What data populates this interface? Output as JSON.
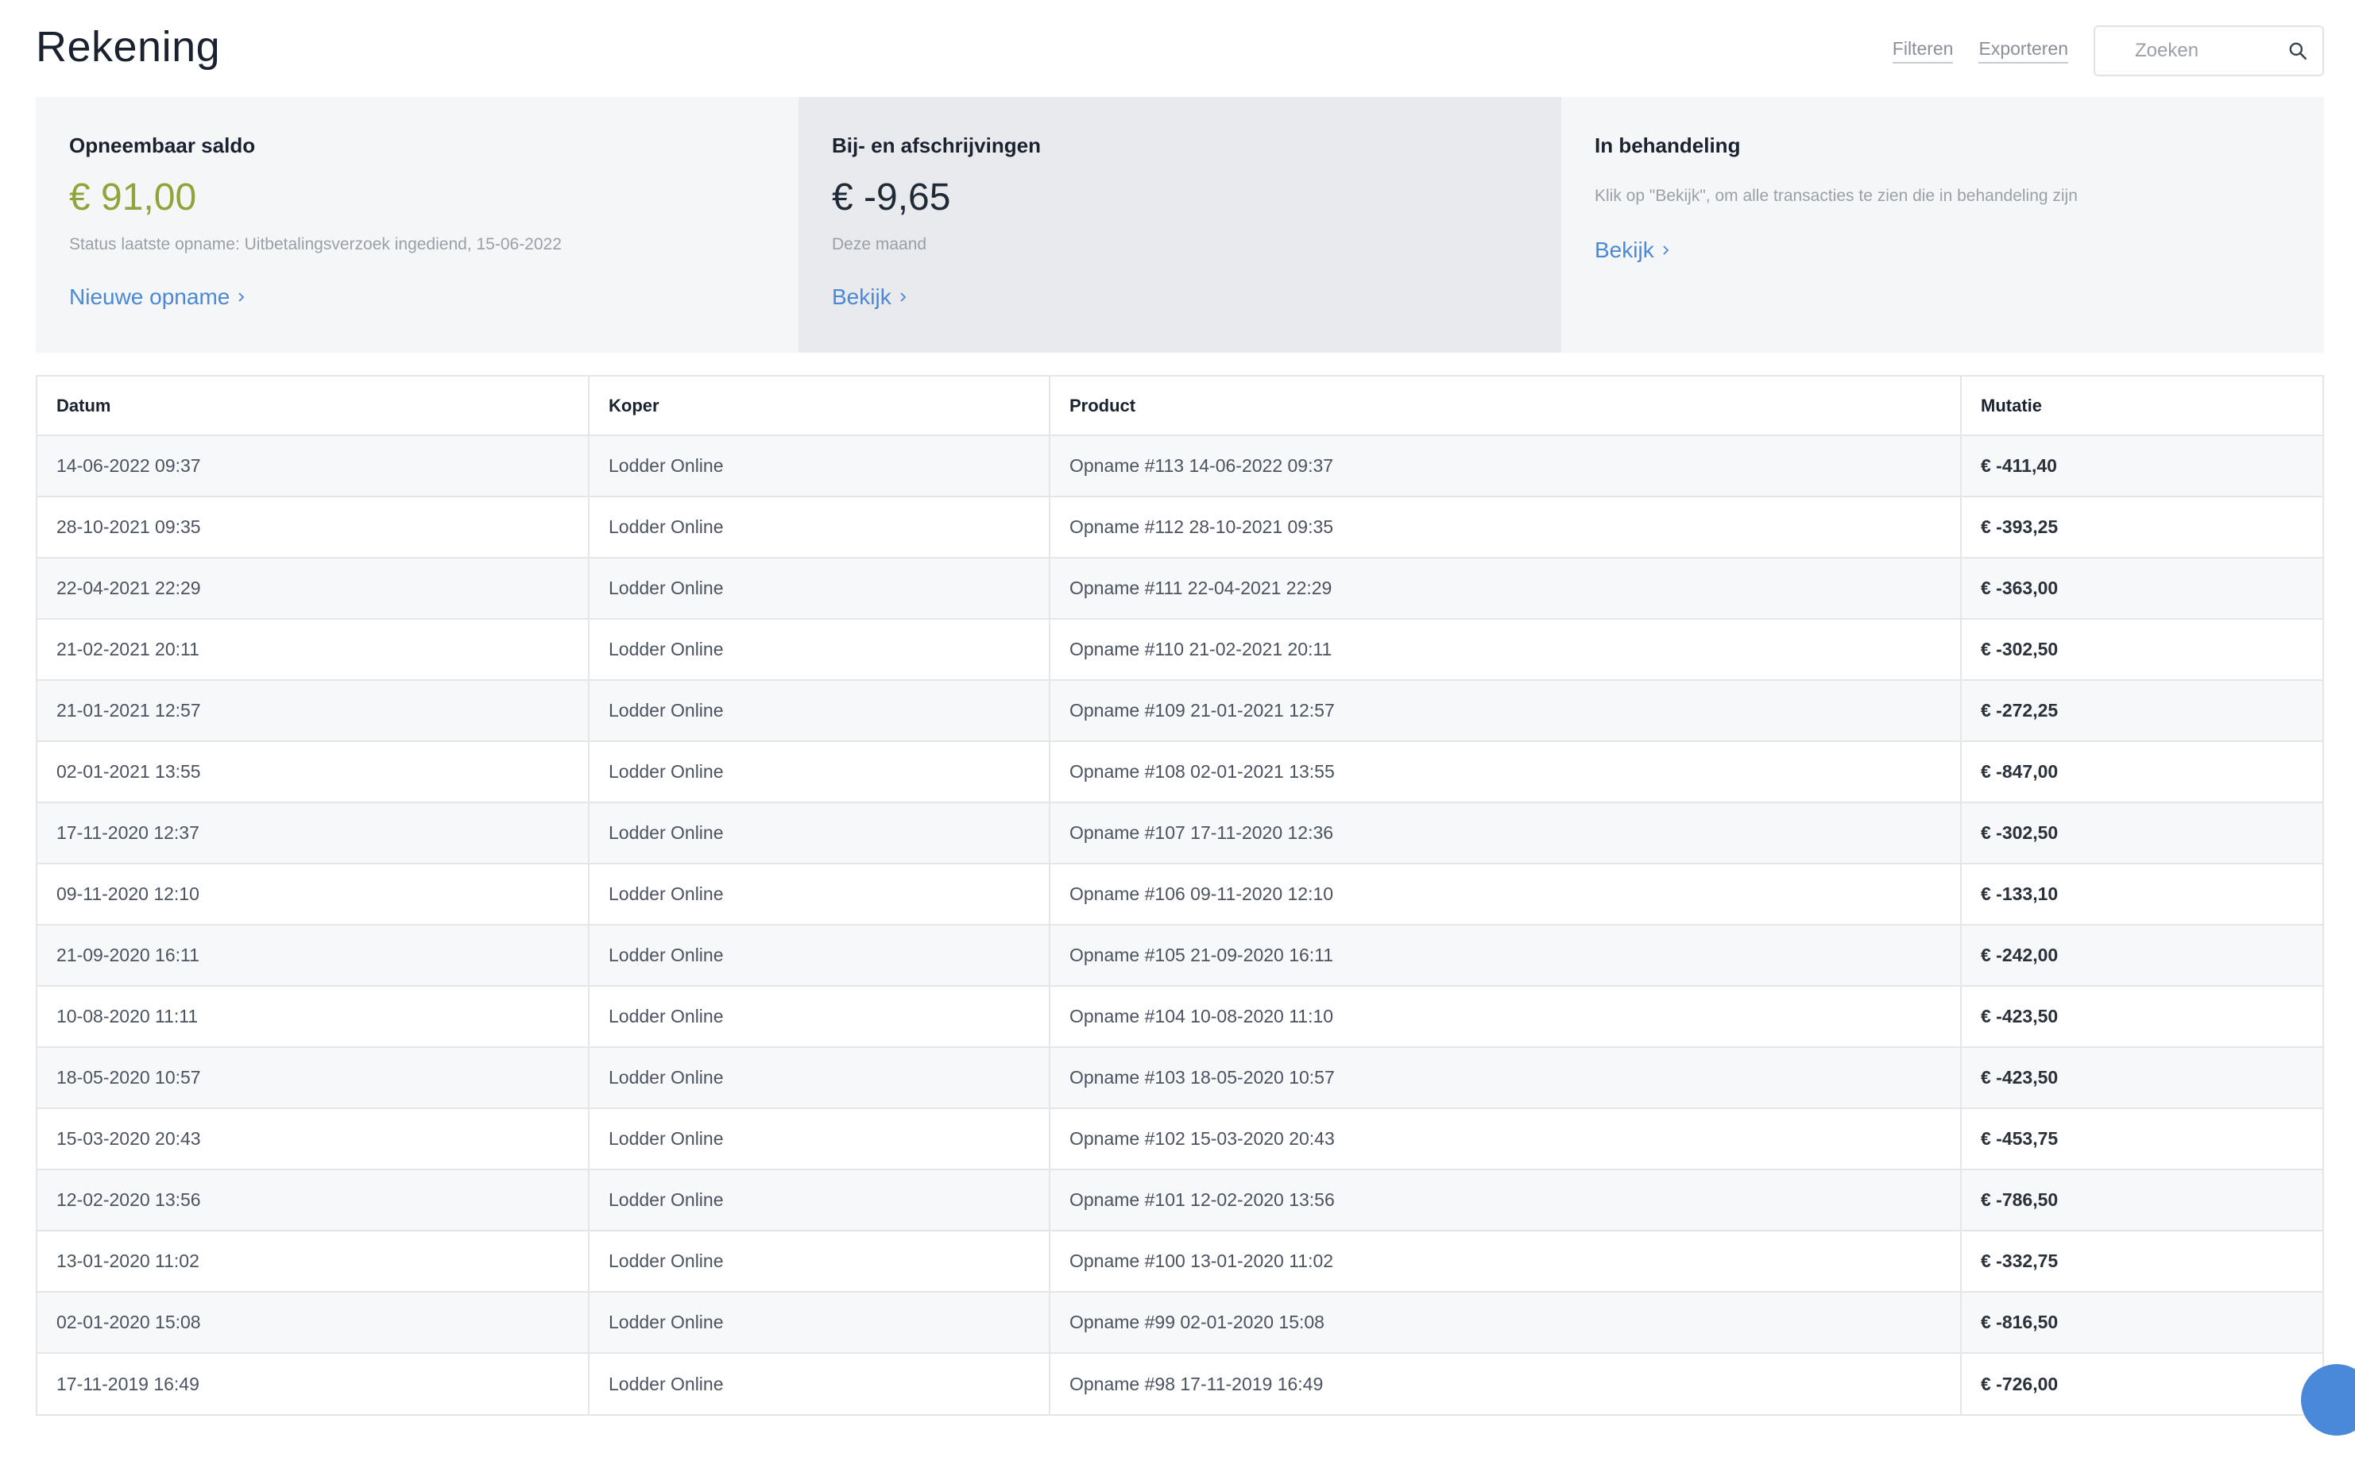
{
  "header": {
    "title": "Rekening",
    "filter_label": "Filteren",
    "export_label": "Exporteren",
    "search": {
      "placeholder": "Zoeken",
      "value": ""
    }
  },
  "cards": {
    "balance": {
      "title": "Opneembaar saldo",
      "value": "€ 91,00",
      "status": "Status laatste opname: Uitbetalingsverzoek ingediend, 15-06-2022",
      "link": "Nieuwe opname"
    },
    "mutations": {
      "title": "Bij- en afschrijvingen",
      "value": "€ -9,65",
      "sub": "Deze maand",
      "link": "Bekijk"
    },
    "pending": {
      "title": "In behandeling",
      "desc": "Klik op \"Bekijk\", om alle transacties te zien die in behandeling zijn",
      "link": "Bekijk"
    }
  },
  "table": {
    "columns": [
      "Datum",
      "Koper",
      "Product",
      "Mutatie"
    ],
    "rows": [
      [
        "14-06-2022 09:37",
        "Lodder Online",
        "Opname #113 14-06-2022 09:37",
        "€ -411,40"
      ],
      [
        "28-10-2021 09:35",
        "Lodder Online",
        "Opname #112 28-10-2021 09:35",
        "€ -393,25"
      ],
      [
        "22-04-2021 22:29",
        "Lodder Online",
        "Opname #111 22-04-2021 22:29",
        "€ -363,00"
      ],
      [
        "21-02-2021 20:11",
        "Lodder Online",
        "Opname #110 21-02-2021 20:11",
        "€ -302,50"
      ],
      [
        "21-01-2021 12:57",
        "Lodder Online",
        "Opname #109 21-01-2021 12:57",
        "€ -272,25"
      ],
      [
        "02-01-2021 13:55",
        "Lodder Online",
        "Opname #108 02-01-2021 13:55",
        "€ -847,00"
      ],
      [
        "17-11-2020 12:37",
        "Lodder Online",
        "Opname #107 17-11-2020 12:36",
        "€ -302,50"
      ],
      [
        "09-11-2020 12:10",
        "Lodder Online",
        "Opname #106 09-11-2020 12:10",
        "€ -133,10"
      ],
      [
        "21-09-2020 16:11",
        "Lodder Online",
        "Opname #105 21-09-2020 16:11",
        "€ -242,00"
      ],
      [
        "10-08-2020 11:11",
        "Lodder Online",
        "Opname #104 10-08-2020 11:10",
        "€ -423,50"
      ],
      [
        "18-05-2020 10:57",
        "Lodder Online",
        "Opname #103 18-05-2020 10:57",
        "€ -423,50"
      ],
      [
        "15-03-2020 20:43",
        "Lodder Online",
        "Opname #102 15-03-2020 20:43",
        "€ -453,75"
      ],
      [
        "12-02-2020 13:56",
        "Lodder Online",
        "Opname #101 12-02-2020 13:56",
        "€ -786,50"
      ],
      [
        "13-01-2020 11:02",
        "Lodder Online",
        "Opname #100 13-01-2020 11:02",
        "€ -332,75"
      ],
      [
        "02-01-2020 15:08",
        "Lodder Online",
        "Opname #99 02-01-2020 15:08",
        "€ -816,50"
      ],
      [
        "17-11-2019 16:49",
        "Lodder Online",
        "Opname #98 17-11-2019 16:49",
        "€ -726,00"
      ]
    ]
  },
  "icons": {
    "search": "search-icon",
    "chevron": "chevron-right-icon",
    "help": "help-chat-icon"
  },
  "colors": {
    "accent": "#4a88d9",
    "balance": "#8ea53a",
    "card_bg": "#f5f6f8",
    "card_active_bg": "#e9eaee"
  }
}
